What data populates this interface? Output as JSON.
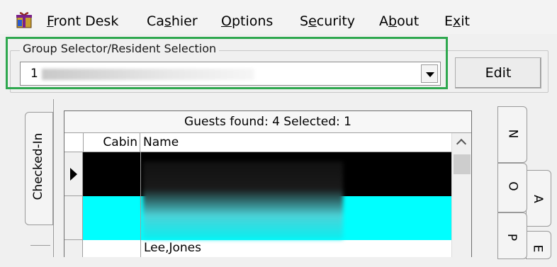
{
  "menubar": {
    "icon": "gift-icon",
    "items": [
      {
        "pre": "",
        "u": "F",
        "post": "ront Desk"
      },
      {
        "pre": "Ca",
        "u": "s",
        "post": "hier"
      },
      {
        "pre": "",
        "u": "O",
        "post": "ptions"
      },
      {
        "pre": "S",
        "u": "e",
        "post": "curity"
      },
      {
        "pre": "A",
        "u": "b",
        "post": "out"
      },
      {
        "pre": "E",
        "u": "x",
        "post": "it"
      }
    ]
  },
  "group_selector": {
    "legend": "Group Selector/Resident Selection",
    "value_prefix": "1",
    "edit_label": "Edit"
  },
  "left_tabs": [
    "Checked-In"
  ],
  "right_tabs": [
    "N",
    "O",
    "P"
  ],
  "right_tabs_back": [
    "A",
    "E"
  ],
  "grid": {
    "caption": "Guests found: 4 Selected: 1",
    "headers": {
      "cabin": "Cabin",
      "name": "Name"
    },
    "rows": [
      {
        "cabin": "",
        "name": "",
        "selected": true
      },
      {
        "cabin": "",
        "name": ""
      },
      {
        "cabin": "",
        "name": "Lee,Jones"
      }
    ]
  },
  "colors": {
    "highlight_border": "#2fa84f",
    "selected_row": "#000000",
    "highlighted_row": "#00ffff"
  }
}
